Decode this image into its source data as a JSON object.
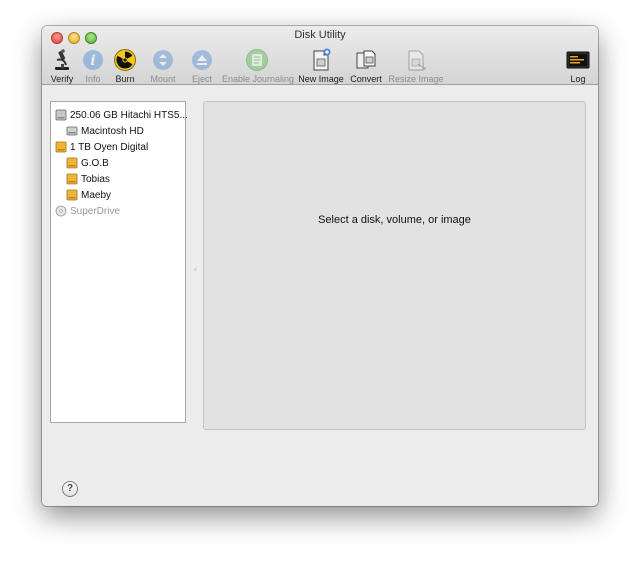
{
  "window": {
    "title": "Disk Utility"
  },
  "toolbar": {
    "verify": "Verify",
    "info": "Info",
    "burn": "Burn",
    "mount": "Mount",
    "eject": "Eject",
    "enable_journaling": "Enable Journaling",
    "new_image": "New Image",
    "convert": "Convert",
    "resize_image": "Resize Image",
    "log": "Log"
  },
  "sidebar": {
    "items": [
      {
        "label": "250.06 GB Hitachi HTS5..."
      },
      {
        "label": "Macintosh HD"
      },
      {
        "label": "1 TB Oyen Digital"
      },
      {
        "label": "G.O.B"
      },
      {
        "label": "Tobias"
      },
      {
        "label": "Maeby"
      },
      {
        "label": "SuperDrive"
      }
    ]
  },
  "main": {
    "message": "Select a disk, volume, or image"
  },
  "help": {
    "label": "?"
  }
}
